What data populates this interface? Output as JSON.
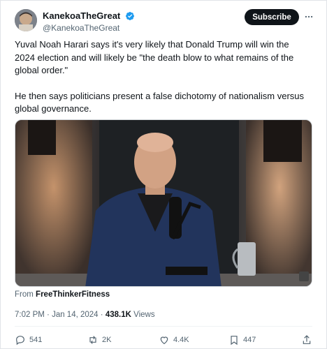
{
  "author": {
    "display_name": "KanekoaTheGreat",
    "handle": "@KanekoaTheGreat",
    "avatar_icon": "avatar-image",
    "verified_icon": "verified-badge-icon",
    "verified_color": "#1d9bf0"
  },
  "header": {
    "subscribe_label": "Subscribe",
    "more_icon": "more-horizontal-icon"
  },
  "tweet": {
    "paragraphs": [
      "Yuval Noah Harari says it's very likely that Donald Trump will win the 2024 election and will likely be \"the death blow to what remains of the global order.\"",
      "He then says politicians present a false dichotomy of nationalism versus global governance."
    ]
  },
  "media": {
    "source_prefix": "From",
    "source_name": "FreeThinkerFitness"
  },
  "meta": {
    "time": "7:02 PM",
    "separator": " · ",
    "date": "Jan 14, 2024",
    "views_count": "438.1K",
    "views_label": "Views"
  },
  "actions": {
    "replies": "541",
    "reposts": "2K",
    "likes": "4.4K",
    "bookmarks": "447"
  },
  "colors": {
    "text": "#0f1419",
    "secondary": "#536471",
    "button_bg": "#0f1419"
  }
}
